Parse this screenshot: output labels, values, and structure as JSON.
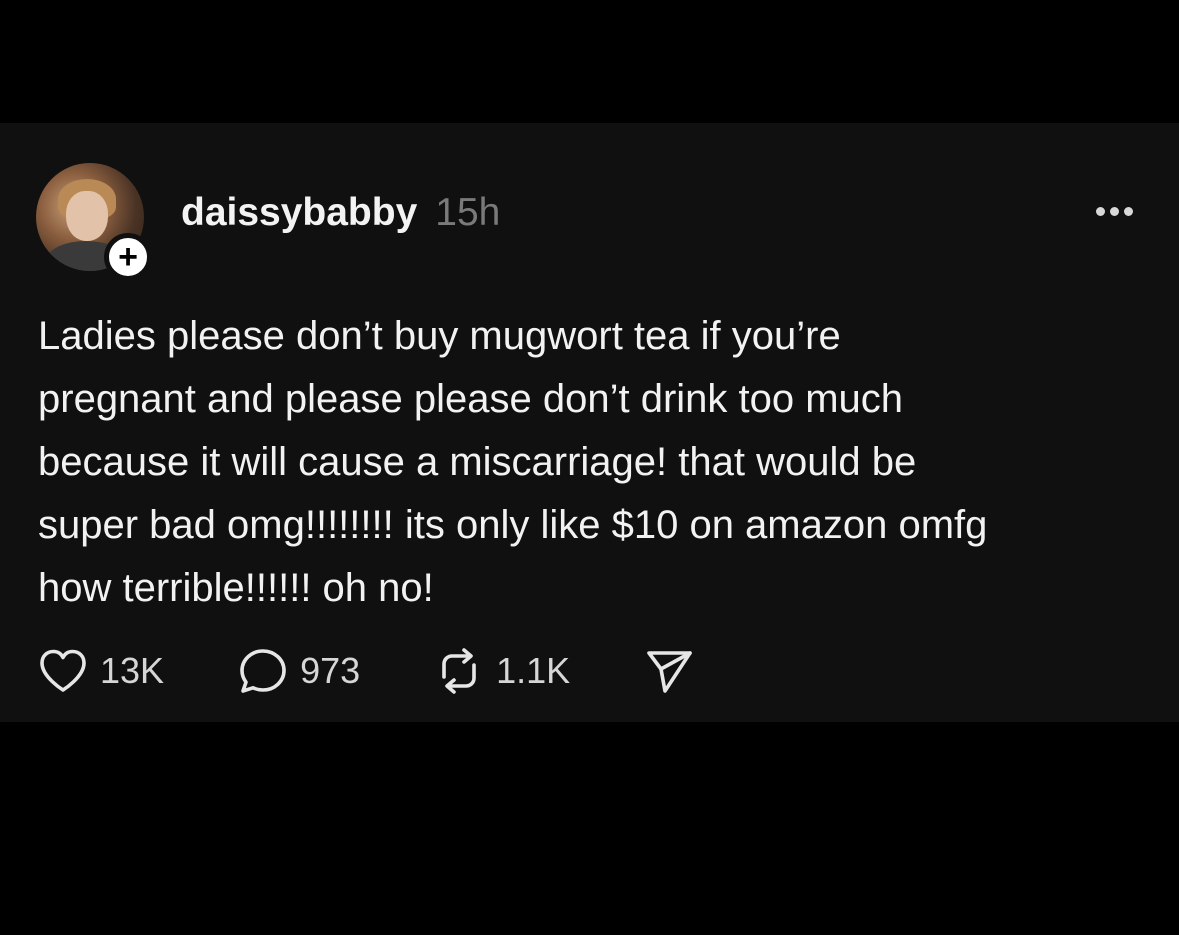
{
  "post": {
    "username": "daissybabby",
    "timestamp": "15h",
    "follow_symbol": "+",
    "text": "Ladies please don’t buy mugwort tea if you’re\npregnant and please please don’t drink too much\nbecause it will cause a miscarriage! that would be\nsuper bad omg!!!!!!!! its only like $10 on amazon omfg\nhow terrible!!!!!! oh no!",
    "actions": {
      "likes": "13K",
      "replies": "973",
      "reposts": "1.1K"
    },
    "icons": {
      "like": "heart-icon",
      "reply": "speech-bubble-icon",
      "repost": "repost-icon",
      "share": "send-icon",
      "more": "more-dots-icon"
    }
  },
  "colors": {
    "background": "#000000",
    "card": "#101010",
    "text": "#f2f2f2",
    "muted": "#7a7a7a"
  }
}
